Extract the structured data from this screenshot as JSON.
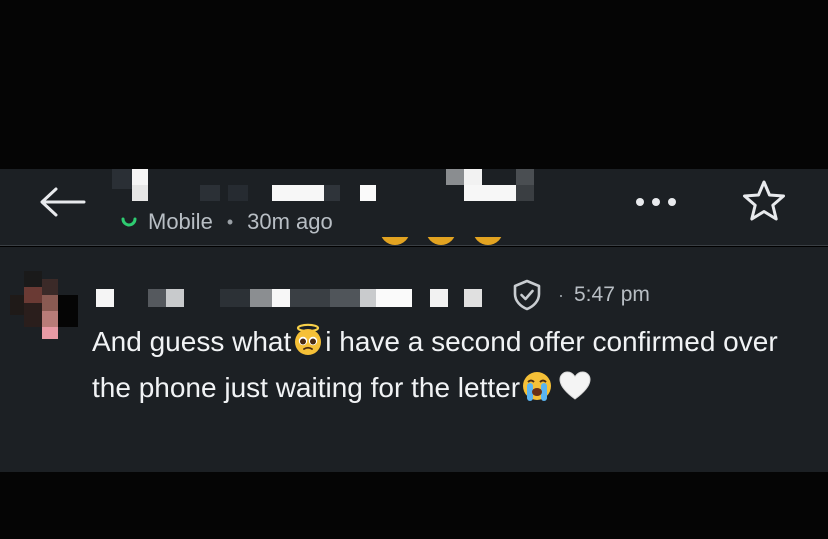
{
  "header": {
    "back_label": "Back",
    "meta": {
      "source": "Mobile",
      "time_ago": "30m ago"
    },
    "more_label": "More options",
    "favorite_label": "Favorite"
  },
  "comment": {
    "timestamp": "5:47 pm",
    "text_part1": "And guess what",
    "text_part2": "i have a second offer confirmed over the phone just waiting for the letter",
    "emoji_1": "pleading-face-with-halo",
    "emoji_2": "loudly-crying-face",
    "emoji_3": "white-heart"
  },
  "colors": {
    "background": "#1c2024",
    "text": "#f1f3f5",
    "muted": "#b8bec4",
    "online_green": "#2ecc71",
    "emoji_yellow": "#f5c037"
  }
}
